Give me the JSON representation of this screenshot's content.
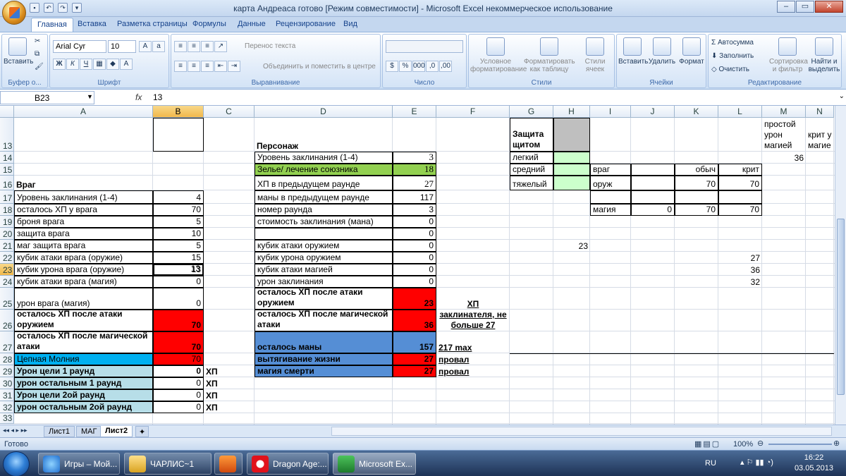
{
  "window": {
    "title": "карта Андреаса готово  [Режим совместимости] - Microsoft Excel некоммерческое использование"
  },
  "ribbon": {
    "tabs": [
      "Главная",
      "Вставка",
      "Разметка страницы",
      "Формулы",
      "Данные",
      "Рецензирование",
      "Вид"
    ],
    "groups": {
      "clipboard": "Буфер о...",
      "font": "Шрифт",
      "align": "Выравнивание",
      "number": "Число",
      "styles": "Стили",
      "cells": "Ячейки",
      "edit": "Редактирование"
    },
    "paste": "Вставить",
    "font_name": "Arial Cyr",
    "font_size": "10",
    "wrap_text": "Перенос текста",
    "merge_center": "Объединить и поместить в центре",
    "cond_format": "Условное форматирование",
    "table_format": "Форматировать как таблицу",
    "cell_styles": "Стили ячеек",
    "insert": "Вставить",
    "delete": "Удалить",
    "format": "Формат",
    "autosum": "Автосумма",
    "fill": "Заполнить",
    "clear": "Очистить",
    "sort": "Сортировка и фильтр",
    "find": "Найти и выделить"
  },
  "formula_bar": {
    "name_box": "B23",
    "fx": "fx",
    "value": "13"
  },
  "columns": [
    "A",
    "B",
    "C",
    "D",
    "E",
    "F",
    "G",
    "H",
    "I",
    "J",
    "K",
    "L",
    "M",
    "N"
  ],
  "rows": [
    "13",
    "14",
    "15",
    "16",
    "17",
    "18",
    "19",
    "20",
    "21",
    "22",
    "23",
    "24",
    "25",
    "26",
    "27",
    "28",
    "29",
    "30",
    "31",
    "32",
    "33"
  ],
  "cells": {
    "A16": "Враг",
    "A17": "Уровень заклинания (1-4)",
    "B17": "4",
    "A18": "осталось ХП у врага",
    "B18": "70",
    "A19": "броня врага",
    "B19": "5",
    "A20": "защита врага",
    "B20": "10",
    "A21": "маг защита врага",
    "B21": "5",
    "A22": "кубик атаки врага (оружие)",
    "B22": "15",
    "A23": "кубик урона врага (оружие)",
    "B23": "13",
    "A24": "кубик атаки врага (магия)",
    "B24": "0",
    "A25": "урон врага (магия)",
    "B25": "0",
    "A26": "осталось ХП после атаки оружием",
    "B26": "70",
    "A27": "осталось ХП после магической атаки",
    "B27": "70",
    "A28": "Цепная Молния",
    "B28": "70",
    "A29": "Урон цели 1 раунд",
    "B29": "0",
    "C29": "ХП",
    "A30": "урон остальным 1 раунд",
    "B30": "0",
    "C30": "ХП",
    "A31": "Урон цели 2ой раунд",
    "B31": "0",
    "C31": "ХП",
    "A32": "урон остальным 2ой раунд",
    "B32": "0",
    "C32": "ХП",
    "D13": "Персонаж",
    "D14": "Уровень заклинания (1-4)",
    "E14": "3",
    "D15": "Зелье/ лечение союзника",
    "E15": "18",
    "D16": "ХП в предыдущем раунде",
    "E16": "27",
    "D17": "маны в предыдущем раунде",
    "E17": "117",
    "D18": "номер раунда",
    "E18": "3",
    "D19": "стоимость заклинания (мана)",
    "E19": "0",
    "E20": "0",
    "D21": "кубик атаки оружием",
    "E21": "0",
    "D22": "кубик урона оружием",
    "E22": "0",
    "D23": "кубик атаки магией",
    "E23": "0",
    "D24": "урон заклинания",
    "E24": "0",
    "D25": "осталось ХП после атаки оружием",
    "E25": "23",
    "D26": "осталось ХП после магической атаки",
    "E26": "36",
    "D27": "осталось маны",
    "E27": "157",
    "D28": "вытягивание жизни",
    "E28": "27",
    "D29": "магия смерти",
    "E29": "27",
    "F25": "ХП заклинателя, не больше 27",
    "F27": "217 max",
    "F28": "провал",
    "F29": "провал",
    "G13": "Защита щитом",
    "G14": "легкий",
    "G15": "средний",
    "G16": "тяжелый",
    "I15": "враг",
    "K15": "обыч",
    "L15": "крит",
    "I16": "оруж",
    "K16": "70",
    "L16": "70",
    "I18": "магия",
    "J18": "0",
    "K18": "70",
    "L18": "70",
    "H21": "23",
    "L22": "27",
    "L23": "36",
    "L24": "32",
    "M13": "простой урон магией",
    "M14": "36",
    "N13": "крит у магие"
  },
  "sheets": [
    "Лист1",
    "МАГ",
    "Лист2"
  ],
  "status": {
    "ready": "Готово",
    "zoom": "100%"
  },
  "taskbar": {
    "items": [
      "Игры – Мой...",
      "ЧАРЛИС~1",
      "",
      "Dragon Age:...",
      "Microsoft Ex..."
    ],
    "lang": "RU",
    "time": "16:22",
    "date": "03.05.2013"
  }
}
